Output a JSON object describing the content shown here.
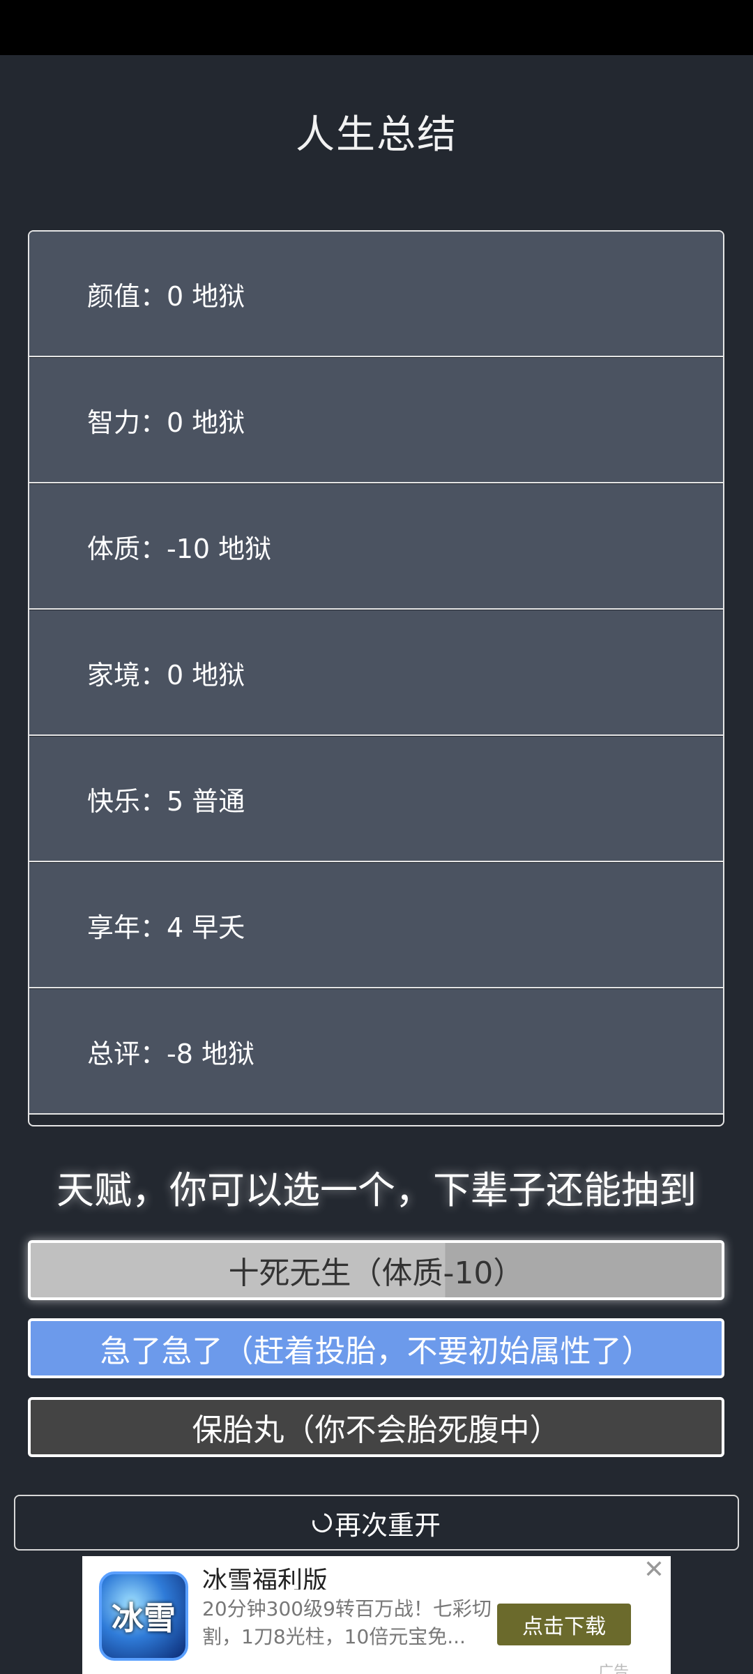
{
  "page": {
    "title": "人生总结"
  },
  "summary": [
    {
      "label": "颜值：0 地狱"
    },
    {
      "label": "智力：0 地狱"
    },
    {
      "label": "体质：-10 地狱"
    },
    {
      "label": "家境：0 地狱"
    },
    {
      "label": "快乐：5 普通"
    },
    {
      "label": "享年：4 早夭"
    },
    {
      "label": "总评：-8 地狱"
    }
  ],
  "talents": {
    "prompt": "天赋，你可以选一个，下辈子还能抽到",
    "items": [
      {
        "label": "十死无生（体质-10）",
        "state": "selected"
      },
      {
        "label": "急了急了（赶着投胎，不要初始属性了）",
        "state": "blue"
      },
      {
        "label": "保胎丸（你不会胎死腹中）",
        "state": "dark"
      }
    ]
  },
  "actions": {
    "restart_label": "再次重开",
    "restart_icon": "refresh-icon"
  },
  "ad": {
    "icon_text": "冰雪",
    "title": "冰雪福利版",
    "description": "20分钟300级9转百万战！七彩切割，1刀8光柱，10倍元宝免...",
    "cta": "点击下载",
    "close_icon": "close-icon",
    "tag": "广告"
  },
  "colors": {
    "background": "#232830",
    "row": "#4b5361",
    "talent_selected": "#c0c0c0",
    "talent_blue": "#6c9aeb",
    "talent_dark": "#444444",
    "ad_cta": "#6b6a2c"
  }
}
